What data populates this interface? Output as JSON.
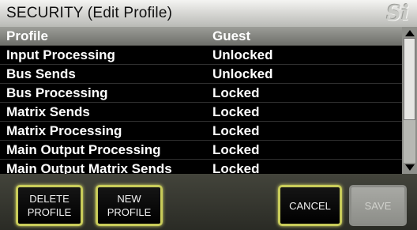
{
  "title": "SECURITY (Edit Profile)",
  "logo_text": "Si",
  "table": {
    "header": {
      "col1": "Profile",
      "col2": "Guest"
    },
    "rows": [
      {
        "name": "Input Processing",
        "status": "Unlocked"
      },
      {
        "name": "Bus Sends",
        "status": "Unlocked"
      },
      {
        "name": "Bus Processing",
        "status": "Locked"
      },
      {
        "name": "Matrix Sends",
        "status": "Locked"
      },
      {
        "name": "Matrix Processing",
        "status": "Locked"
      },
      {
        "name": "Main Output Processing",
        "status": "Locked"
      },
      {
        "name": "Main Output Matrix Sends",
        "status": "Locked"
      }
    ]
  },
  "buttons": {
    "delete_profile": "DELETE\nPROFILE",
    "new_profile": "NEW\nPROFILE",
    "cancel": "CANCEL",
    "save": "SAVE"
  },
  "colors": {
    "button_highlight": "#c9cc5a",
    "table_background": "#000000",
    "header_background": "#8a8b86"
  },
  "scrollbar": {
    "visible_fraction": 0.66
  }
}
